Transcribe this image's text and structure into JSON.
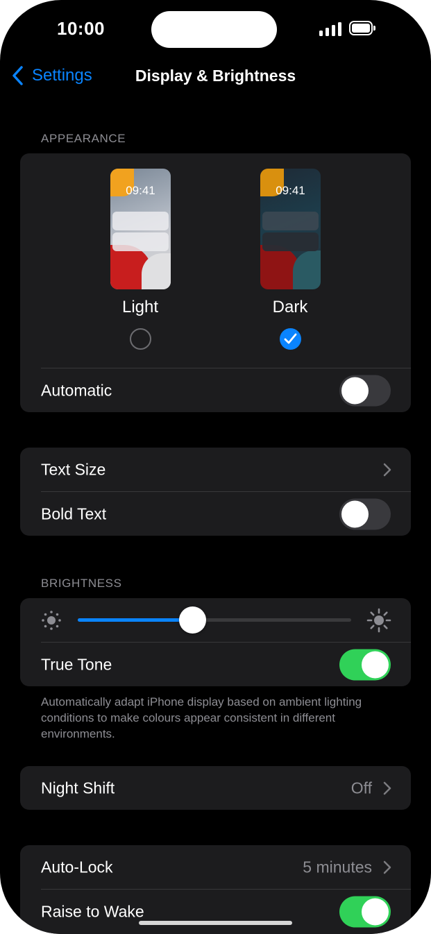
{
  "status_bar": {
    "time": "10:00"
  },
  "nav": {
    "back_label": "Settings",
    "title": "Display & Brightness"
  },
  "appearance": {
    "header": "APPEARANCE",
    "light": {
      "label": "Light",
      "preview_time": "09:41",
      "selected": false
    },
    "dark": {
      "label": "Dark",
      "preview_time": "09:41",
      "selected": true
    },
    "automatic": {
      "label": "Automatic",
      "on": false
    }
  },
  "text": {
    "text_size": {
      "label": "Text Size"
    },
    "bold_text": {
      "label": "Bold Text",
      "on": false
    }
  },
  "brightness": {
    "header": "BRIGHTNESS",
    "level_percent": 42,
    "true_tone": {
      "label": "True Tone",
      "on": true
    },
    "footer": "Automatically adapt iPhone display based on ambient lighting conditions to make colours appear consistent in different environments."
  },
  "night_shift": {
    "label": "Night Shift",
    "value": "Off"
  },
  "lock": {
    "auto_lock": {
      "label": "Auto-Lock",
      "value": "5 minutes"
    },
    "raise_to_wake": {
      "label": "Raise to Wake",
      "on": true
    }
  },
  "colors": {
    "accent": "#0A84FF",
    "toggle_on": "#30D158",
    "cell": "#1C1C1E",
    "secondary_text": "#8D8D93"
  }
}
